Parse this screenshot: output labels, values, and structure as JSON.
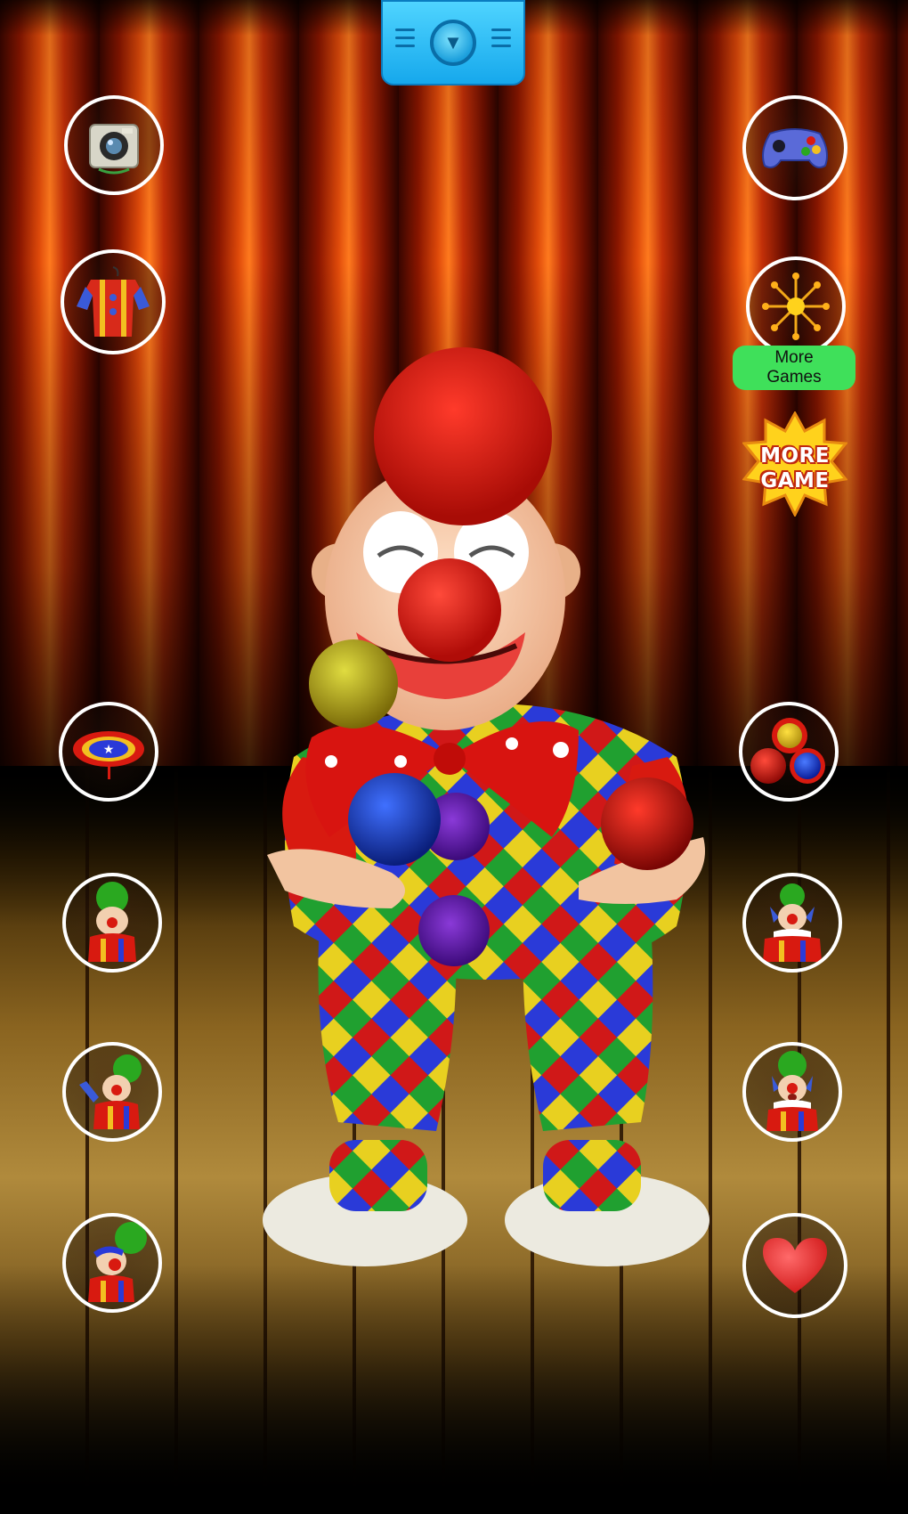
{
  "top_menu": {
    "icon": "triangle-down-icon",
    "colors": {
      "base": "#1ab0f0",
      "dark": "#0a6ea8"
    }
  },
  "left_buttons": [
    {
      "icon": "camera-icon"
    },
    {
      "icon": "clown-costume-icon"
    },
    {
      "icon": "trampoline-icon"
    },
    {
      "icon": "clown-pie-icon"
    },
    {
      "icon": "clown-wave-icon"
    },
    {
      "icon": "clown-balloon-icon"
    }
  ],
  "right_buttons": [
    {
      "icon": "gamepad-icon"
    },
    {
      "icon": "firework-icon",
      "label": "More\nGames"
    },
    {
      "icon": "juggling-balls-icon"
    },
    {
      "icon": "clown-laugh-icon"
    },
    {
      "icon": "clown-surprise-icon"
    },
    {
      "icon": "heart-icon"
    }
  ],
  "more_games_label": "More\nGames",
  "more_game_badge": {
    "line1": "MORE",
    "line2": "GAME"
  },
  "colors": {
    "curtain": "#c43008",
    "floor": "#b08a3c",
    "more_label_bg": "#3fe05a",
    "badge_star": "#ffd21c",
    "badge_text_outline": "#c0270f"
  }
}
